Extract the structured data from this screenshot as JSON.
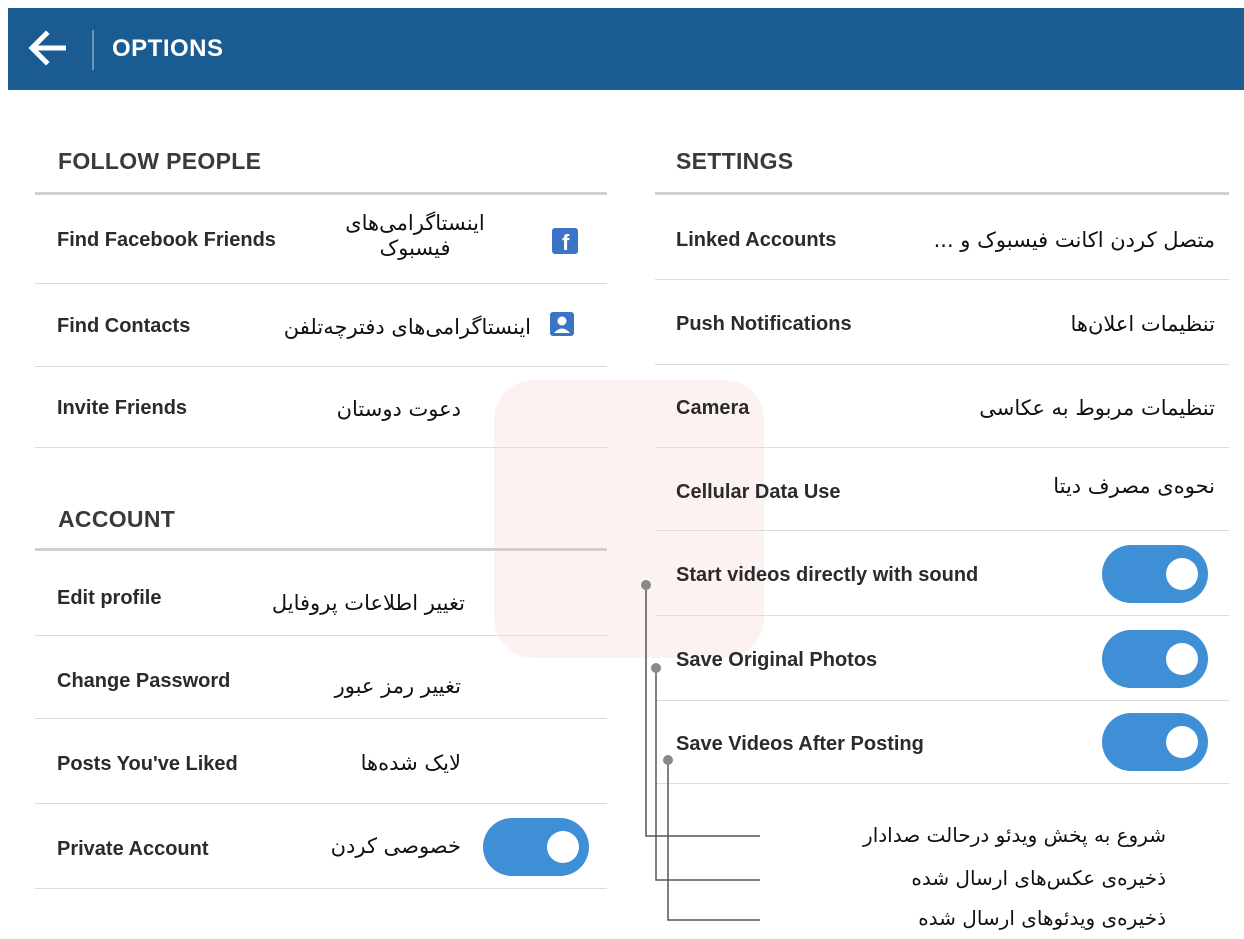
{
  "header": {
    "title": "OPTIONS"
  },
  "follow_people": {
    "title": "FOLLOW PEOPLE",
    "items": [
      {
        "label": "Find Facebook Friends",
        "fa": "اینستاگرامی‌های فیسبوک",
        "icon": "facebook-icon"
      },
      {
        "label": "Find Contacts",
        "fa": "اینستاگرامی‌های دفترچه‌تلفن",
        "icon": "contacts-icon"
      },
      {
        "label": "Invite Friends",
        "fa": "دعوت دوستان"
      }
    ]
  },
  "account": {
    "title": "ACCOUNT",
    "items": [
      {
        "label": "Edit profile",
        "fa": "تغییر اطلاعات پروفایل"
      },
      {
        "label": "Change Password",
        "fa": "تغییر رمز عبور"
      },
      {
        "label": "Posts You've Liked",
        "fa": "لایک شده‌ها"
      },
      {
        "label": "Private Account",
        "fa": "خصوصی کردن",
        "toggle": true
      }
    ]
  },
  "settings": {
    "title": "SETTINGS",
    "items": [
      {
        "label": "Linked Accounts",
        "fa": "متصل کردن اکانت فیسبوک و ..."
      },
      {
        "label": "Push Notifications",
        "fa": "تنظیمات اعلان‌ها"
      },
      {
        "label": "Camera",
        "fa": "تنظیمات مربوط به عکاسی"
      },
      {
        "label": "Cellular Data Use",
        "fa": "نحوه‌ی مصرف دیتا"
      },
      {
        "label": "Start videos directly with sound",
        "toggle": true
      },
      {
        "label": "Save Original Photos",
        "toggle": true
      },
      {
        "label": "Save Videos After Posting",
        "toggle": true
      }
    ]
  },
  "annotations": [
    "شروع به پخش ویدئو درحالت صدادار",
    "ذخیره‌ی عکس‌های ارسال شده",
    "ذخیره‌ی ویدئوهای ارسال شده"
  ],
  "colors": {
    "header_bg": "#1a5c92",
    "toggle_on": "#3f8fd6",
    "icon_blue": "#3b73c6"
  }
}
